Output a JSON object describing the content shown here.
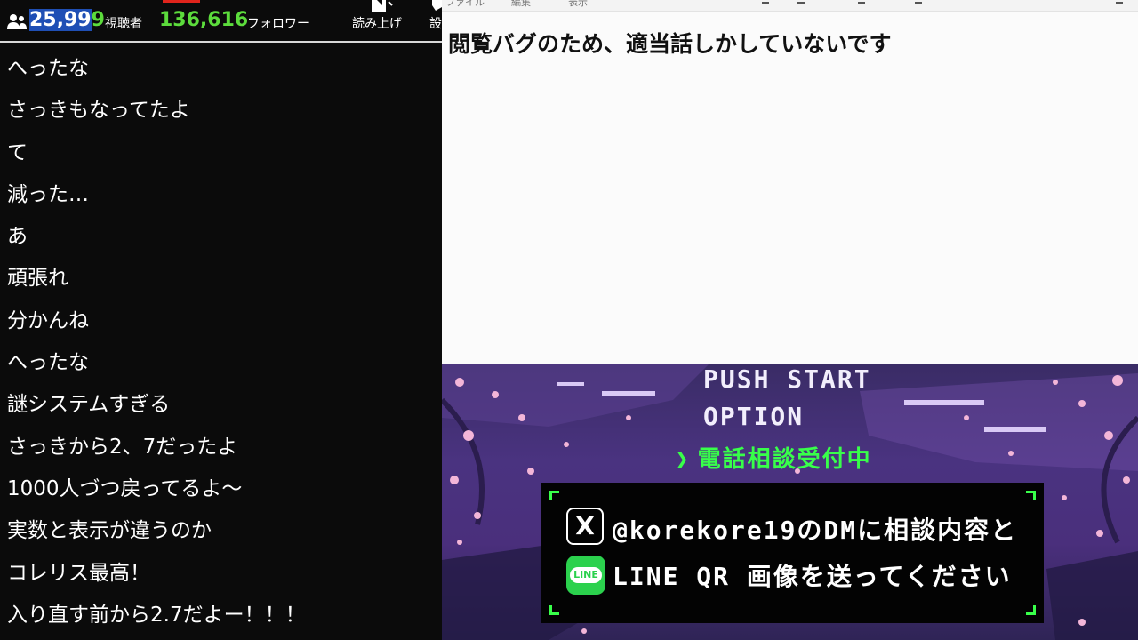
{
  "header": {
    "viewer_count_highlight": "25,99",
    "viewer_count_rest": "9",
    "viewer_label": "視聴者",
    "follower_count": "136,616",
    "follower_label": "フォロワー",
    "tts_label": "読み上げ",
    "settings_label_partial": "設"
  },
  "chat": {
    "messages": [
      "へったな",
      "さっきもなってたよ",
      "て",
      "減った…",
      "あ",
      "頑張れ",
      "分かんね",
      "へったな",
      "謎システムすぎる",
      "さっきから2、7だったよ",
      "1000人づつ戻ってるよ〜",
      "実数と表示が違うのか",
      "コレリス最高！",
      "入り直す前から2.7だよー！！！"
    ]
  },
  "editor": {
    "menu": [
      "ファイル",
      "編集",
      "表示"
    ],
    "text": "閲覧バグのため、適当話しかしていないです"
  },
  "banner": {
    "push_start": "PUSH START",
    "option": "OPTION",
    "consult_arrow": "❯",
    "consult_text": "電話相談受付中",
    "x_logo": "X",
    "x_line": "@korekore19のDMに相談内容と",
    "line_logo": "LINE",
    "line_line": "LINE QR 画像を送ってください"
  },
  "colors": {
    "accent_green": "#38ff4a",
    "count_green": "#5cdc3c",
    "highlight_blue": "#1f4fb5",
    "banner_purple": "#4a3380"
  },
  "icons": [
    "viewer-icon",
    "speaker-icon",
    "gear-icon",
    "x-logo-icon",
    "line-logo-icon"
  ]
}
